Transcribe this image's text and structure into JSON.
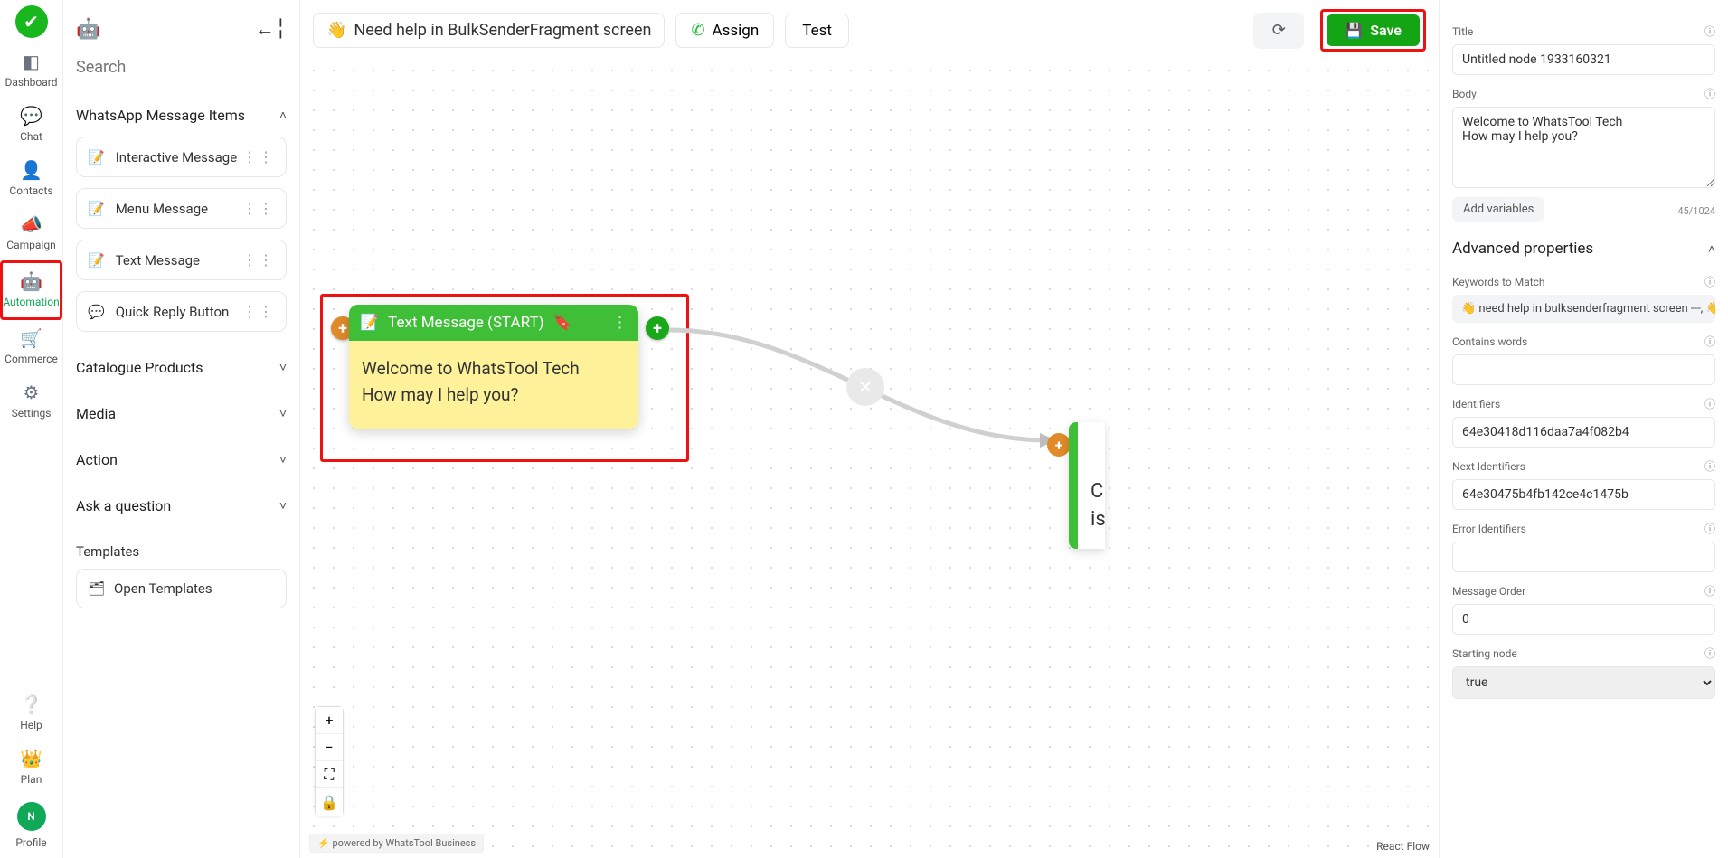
{
  "nav": {
    "dashboard": "Dashboard",
    "chat": "Chat",
    "contacts": "Contacts",
    "campaign": "Campaign",
    "automation": "Automation",
    "commerce": "Commerce",
    "settings": "Settings",
    "help": "Help",
    "plan": "Plan",
    "profile": "Profile",
    "profile_initial": "N"
  },
  "left": {
    "search_placeholder": "Search",
    "sections": {
      "whatsapp_items": "WhatsApp Message Items",
      "catalogue": "Catalogue Products",
      "media": "Media",
      "action": "Action",
      "ask": "Ask a question"
    },
    "items": {
      "interactive": "Interactive Message",
      "menu": "Menu Message",
      "text": "Text Message",
      "quick_reply": "Quick Reply Button"
    },
    "templates": "Templates",
    "open_templates": "Open Templates"
  },
  "top": {
    "title": "Need help in BulkSenderFragment screen",
    "assign": "Assign",
    "test": "Test",
    "save": "Save"
  },
  "canvas": {
    "node_title": "Text Message (START)",
    "node_body": "Welcome to WhatsTool Tech\nHow may I help you?",
    "right_node_preview": "C\nis",
    "powered": "powered by WhatsTool Business",
    "react_flow": "React Flow"
  },
  "props": {
    "title_label": "Title",
    "title_value": "Untitled node 1933160321",
    "body_label": "Body",
    "body_value": "Welcome to WhatsTool Tech\nHow may I help you?",
    "body_counter": "45/1024",
    "add_variables": "Add variables",
    "advanced": "Advanced properties",
    "keywords_label": "Keywords to Match",
    "keywords_value": "👋 need help in bulksenderfragment screen ---, 👋 n",
    "contains_label": "Contains words",
    "contains_value": "",
    "identifiers_label": "Identifiers",
    "identifiers_value": "64e30418d116daa7a4f082b4",
    "next_identifiers_label": "Next Identifiers",
    "next_identifiers_value": "64e30475b4fb142ce4c1475b",
    "error_identifiers_label": "Error Identifiers",
    "error_identifiers_value": "",
    "msg_order_label": "Message Order",
    "msg_order_value": "0",
    "starting_node_label": "Starting node",
    "starting_node_value": "true"
  }
}
